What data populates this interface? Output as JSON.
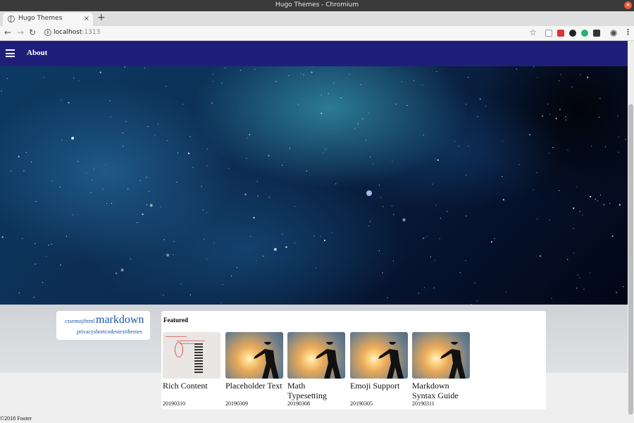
{
  "window": {
    "title": "Hugo Themes - Chromium",
    "close_glyph": "×"
  },
  "browser": {
    "tab_label": "Hugo Themes",
    "tab_close": "×",
    "new_tab": "+",
    "url_host": "localhost",
    "url_port": ":1313",
    "nav": {
      "back": "←",
      "forward": "→",
      "reload": "↻",
      "star": "☆",
      "menu": "⋮",
      "info": "i"
    }
  },
  "site": {
    "nav_link": "About",
    "tag_cloud": {
      "small_tags": "cssemojihtml",
      "large_tag": "markdown",
      "second_row": "privacyshortcodestextthemes"
    },
    "featured": {
      "heading": "Featured",
      "cards": [
        {
          "title": "Rich Content",
          "date": "20190310",
          "image": "document-thumbnail"
        },
        {
          "title": "Placeholder Text",
          "date": "20190309",
          "image": "sunset-silhouette-thumbnail"
        },
        {
          "title": "Math Typesetting",
          "date": "20190308",
          "image": "sunset-silhouette-thumbnail"
        },
        {
          "title": "Emoji Support",
          "date": "20190305",
          "image": "sunset-silhouette-thumbnail"
        },
        {
          "title": "Markdown Syntax Guide",
          "date": "20190311",
          "image": "sunset-silhouette-thumbnail"
        }
      ]
    },
    "footer": "©2018 Footer"
  }
}
